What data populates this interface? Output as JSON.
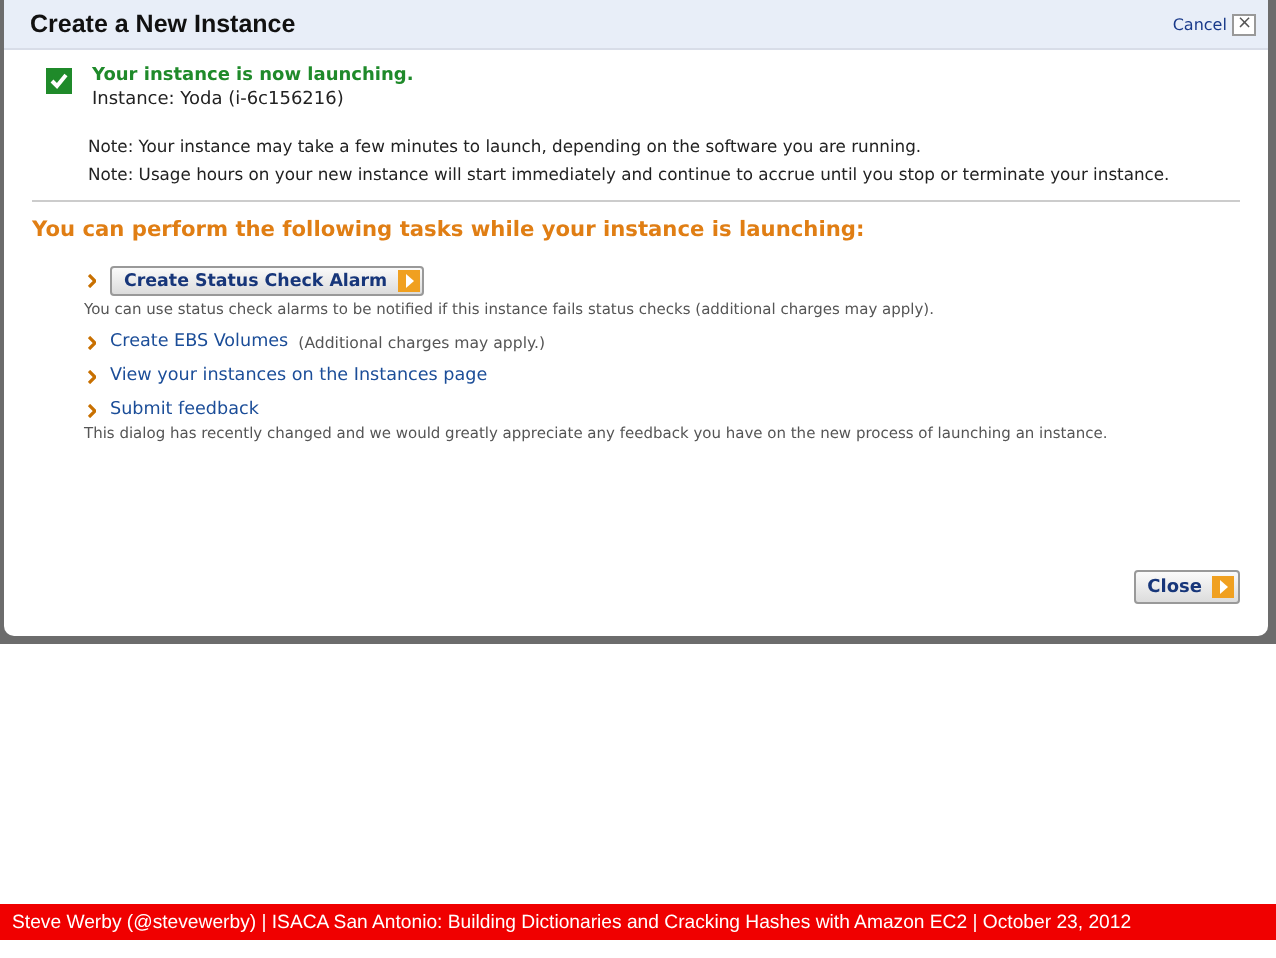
{
  "dialog": {
    "title": "Create a New Instance",
    "cancel": "Cancel",
    "close_glyph": "×",
    "success": {
      "checked": true,
      "heading": "Your instance is now launching.",
      "instance": "Instance: Yoda (i-6c156216)"
    },
    "notes": [
      "Note: Your instance may take a few minutes to launch, depending on the software you are running.",
      "Note: Usage hours on your new instance will start immediately and continue to accrue until you stop or terminate your instance."
    ],
    "tasks_heading": "You can perform the following tasks while your instance is launching:",
    "tasks": [
      {
        "kind": "button",
        "label": "Create Status Check Alarm",
        "help": "You can use status check alarms to be notified if this instance fails status checks (additional charges may apply)."
      },
      {
        "kind": "link",
        "label": "Create EBS Volumes",
        "aside": "(Additional charges may apply.)"
      },
      {
        "kind": "link",
        "label": "View your instances on the Instances page"
      },
      {
        "kind": "link",
        "label": "Submit feedback",
        "help": "This dialog has recently changed and we would greatly appreciate any feedback you have on the new process of launching an instance."
      }
    ],
    "close_button": "Close"
  },
  "footer": "Steve Werby (@stevewerby) | ISACA San Antonio: Building Dictionaries and Cracking Hashes with Amazon EC2 | October 23, 2012"
}
